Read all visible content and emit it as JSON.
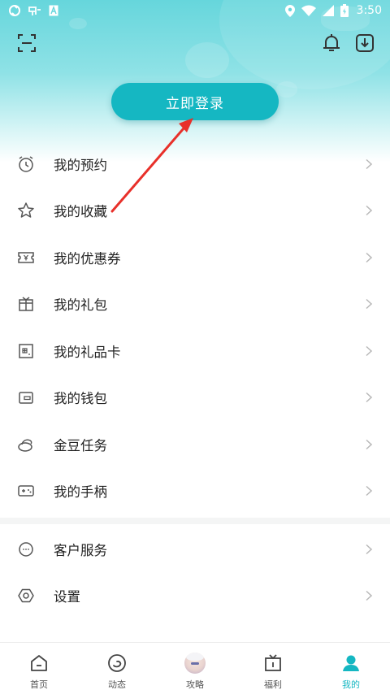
{
  "status_bar": {
    "time": "3:50",
    "left_icons": [
      "sync-icon",
      "app-notification-icon",
      "font-icon"
    ],
    "right_icons": [
      "location-icon",
      "wifi-icon",
      "signal-icon",
      "battery-icon"
    ]
  },
  "header": {
    "left_icon": "scan-icon",
    "right_icons": [
      "bell-icon",
      "download-icon"
    ],
    "login_button": "立即登录"
  },
  "menu": {
    "items": [
      {
        "label": "我的预约",
        "icon": "alarm-clock-icon"
      },
      {
        "label": "我的收藏",
        "icon": "star-icon"
      },
      {
        "label": "我的优惠券",
        "icon": "coupon-icon"
      },
      {
        "label": "我的礼包",
        "icon": "gift-icon"
      },
      {
        "label": "我的礼品卡",
        "icon": "gift-card-icon"
      },
      {
        "label": "我的钱包",
        "icon": "wallet-icon"
      },
      {
        "label": "金豆任务",
        "icon": "bean-icon"
      },
      {
        "label": "我的手柄",
        "icon": "gamepad-icon"
      }
    ],
    "secondary": [
      {
        "label": "客户服务",
        "icon": "customer-service-icon"
      },
      {
        "label": "设置",
        "icon": "settings-icon"
      }
    ]
  },
  "tabbar": {
    "items": [
      {
        "label": "首页",
        "icon": "home-icon",
        "active": false
      },
      {
        "label": "动态",
        "icon": "activity-icon",
        "active": false
      },
      {
        "label": "攻略",
        "icon": "avatar-icon",
        "active": false
      },
      {
        "label": "福利",
        "icon": "tv-gift-icon",
        "active": false
      },
      {
        "label": "我的",
        "icon": "user-icon",
        "active": true
      }
    ]
  },
  "colors": {
    "accent": "#15b7c2",
    "hero_top": "#66d6dc",
    "annotation_arrow": "#e8302a",
    "icon_gray": "#555555",
    "chevron": "#b8b8b8"
  }
}
